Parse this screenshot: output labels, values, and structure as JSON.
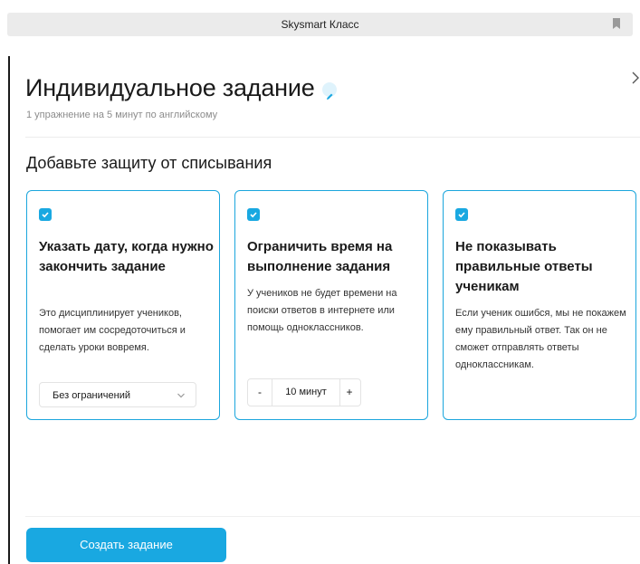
{
  "topbar": {
    "title": "Skysmart Класс",
    "bookmark_icon": "bookmark-icon"
  },
  "header": {
    "title": "Индивидуальное задание",
    "edit_icon": "pencil-icon",
    "subtitle": "1 упражнение на 5 минут по английскому"
  },
  "section": {
    "title": "Добавьте защиту от списывания"
  },
  "cards": [
    {
      "checked": true,
      "heading": "Указать дату, когда нужно закончить задание",
      "text": "Это дисциплинирует учеников, помогает им сосредоточиться и сделать уроки вовремя.",
      "select_value": "Без ограничений"
    },
    {
      "checked": true,
      "heading": "Ограничить время на выполнение задания",
      "text": "У учеников не будет времени на поиски ответов в интернете или помощь одноклассников.",
      "stepper": {
        "minus": "-",
        "value": "10 минут",
        "plus": "+"
      }
    },
    {
      "checked": true,
      "heading": "Не показывать правильные ответы ученикам",
      "text": "Если ученик ошибся, мы не покажем ему правильный ответ. Так он не сможет отправлять ответы одноклассникам."
    }
  ],
  "footer": {
    "create_button": "Создать задание"
  },
  "colors": {
    "accent": "#19a8e1",
    "card_border": "#1ba6dd",
    "text": "#1a1a1a",
    "muted": "#8c8c8c"
  }
}
